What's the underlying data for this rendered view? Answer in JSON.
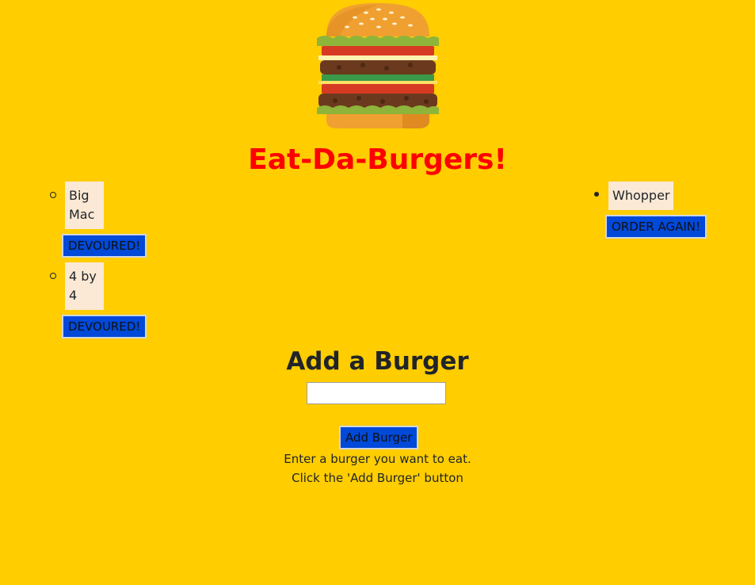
{
  "header": {
    "logo_icon": "burger-icon",
    "title": "Eat-Da-Burgers!"
  },
  "uneaten": {
    "items": [
      {
        "name": "Big Mac",
        "button_label": "DEVOURED!"
      },
      {
        "name": "4 by 4",
        "button_label": "DEVOURED!"
      }
    ]
  },
  "eaten": {
    "items": [
      {
        "name": "Whopper",
        "button_label": "ORDER AGAIN!"
      }
    ]
  },
  "add_form": {
    "heading": "Add a Burger",
    "input_value": "",
    "input_placeholder": "",
    "button_label": "Add Burger",
    "instruction_line1": "Enter a burger you want to eat.",
    "instruction_line2": "Click the 'Add Burger' button"
  },
  "colors": {
    "background": "#ffcd00",
    "title": "#ff0000",
    "button": "#0049d9",
    "item_bg": "#fbe9d5"
  }
}
